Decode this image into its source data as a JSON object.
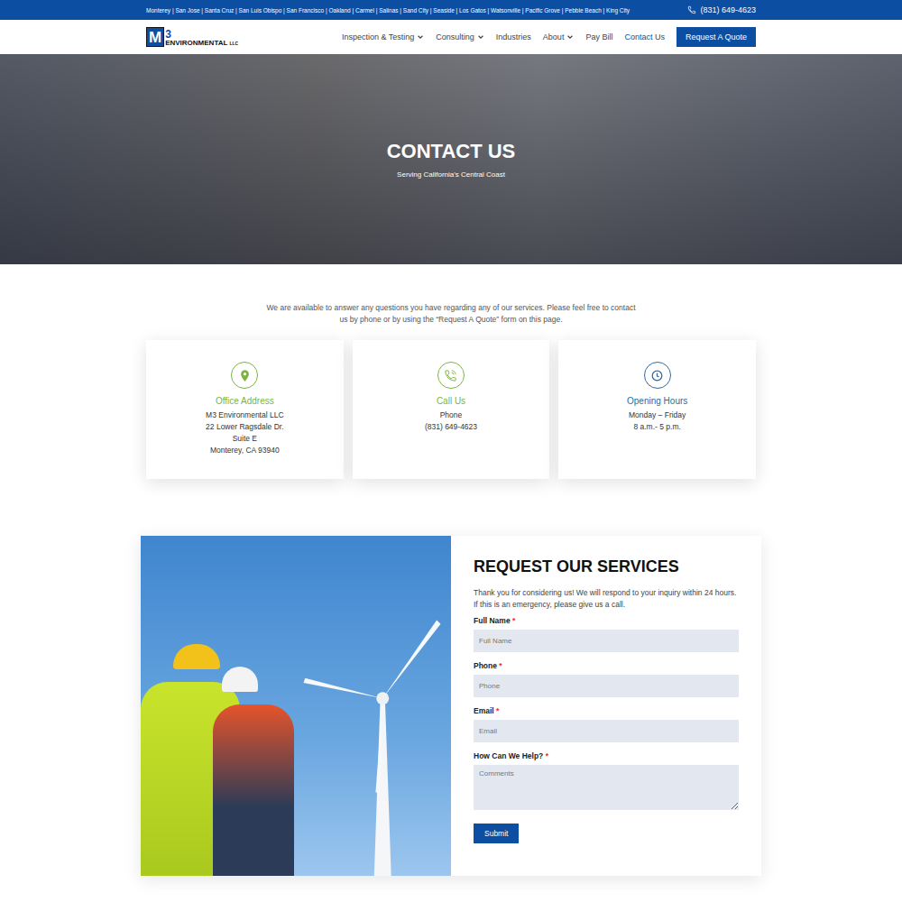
{
  "top_bar": {
    "cities": "Monterey | San Jose | Santa Cruz | San Luis Obispo | San Francisco | Oakland | Carmel | Salinas | Sand City | Seaside | Los Gatos | Watsonville | Pacific Grove | Pebble Beach | King City",
    "phone": "(831) 649-4623"
  },
  "logo": {
    "mark": "M",
    "superscript": "3",
    "name": "ENVIRONMENTAL",
    "suffix": "LLC"
  },
  "nav": {
    "items": [
      {
        "label": "Inspection & Testing",
        "dropdown": true,
        "selected": false
      },
      {
        "label": "Consulting",
        "dropdown": true,
        "selected": false
      },
      {
        "label": "Industries",
        "dropdown": false,
        "selected": false
      },
      {
        "label": "About",
        "dropdown": true,
        "selected": false
      },
      {
        "label": "Pay Bill",
        "dropdown": false,
        "selected": false
      },
      {
        "label": "Contact Us",
        "dropdown": false,
        "selected": true
      }
    ],
    "cta": "Request A Quote"
  },
  "hero": {
    "title": "CONTACT US",
    "subtitle": "Serving California's Central Coast"
  },
  "intro": "We are available to answer any questions you have regarding any of our services. Please feel free to contact us by phone or by using the “Request A Quote” form on this page.",
  "cards": [
    {
      "kind": "address",
      "title": "Office Address",
      "lines": [
        "M3 Environmental LLC",
        "22 Lower Ragsdale Dr.",
        "Suite E",
        "Monterey, CA 93940"
      ],
      "color": "#7cb342"
    },
    {
      "kind": "phone",
      "title": "Call Us",
      "lines": [
        "Phone",
        "(831) 649-4623"
      ],
      "color": "#7cb342"
    },
    {
      "kind": "hours",
      "title": "Opening Hours",
      "lines": [
        "Monday – Friday",
        "8 a.m.- 5 p.m."
      ],
      "color": "#2f6aa3"
    }
  ],
  "form": {
    "title": "REQUEST OUR SERVICES",
    "description": "Thank you for considering us! We will respond to your inquiry within 24 hours. If this is an emergency, please give us a call.",
    "required_mark": "*",
    "fields": [
      {
        "kind": "input",
        "label": "Full Name",
        "required": true,
        "placeholder": "Full Name"
      },
      {
        "kind": "input",
        "label": "Phone",
        "required": true,
        "placeholder": "Phone"
      },
      {
        "kind": "input",
        "label": "Email",
        "required": true,
        "placeholder": "Email"
      },
      {
        "kind": "textarea",
        "label": "How Can We Help?",
        "required": true,
        "placeholder": "Comments"
      }
    ],
    "submit": "Submit"
  }
}
